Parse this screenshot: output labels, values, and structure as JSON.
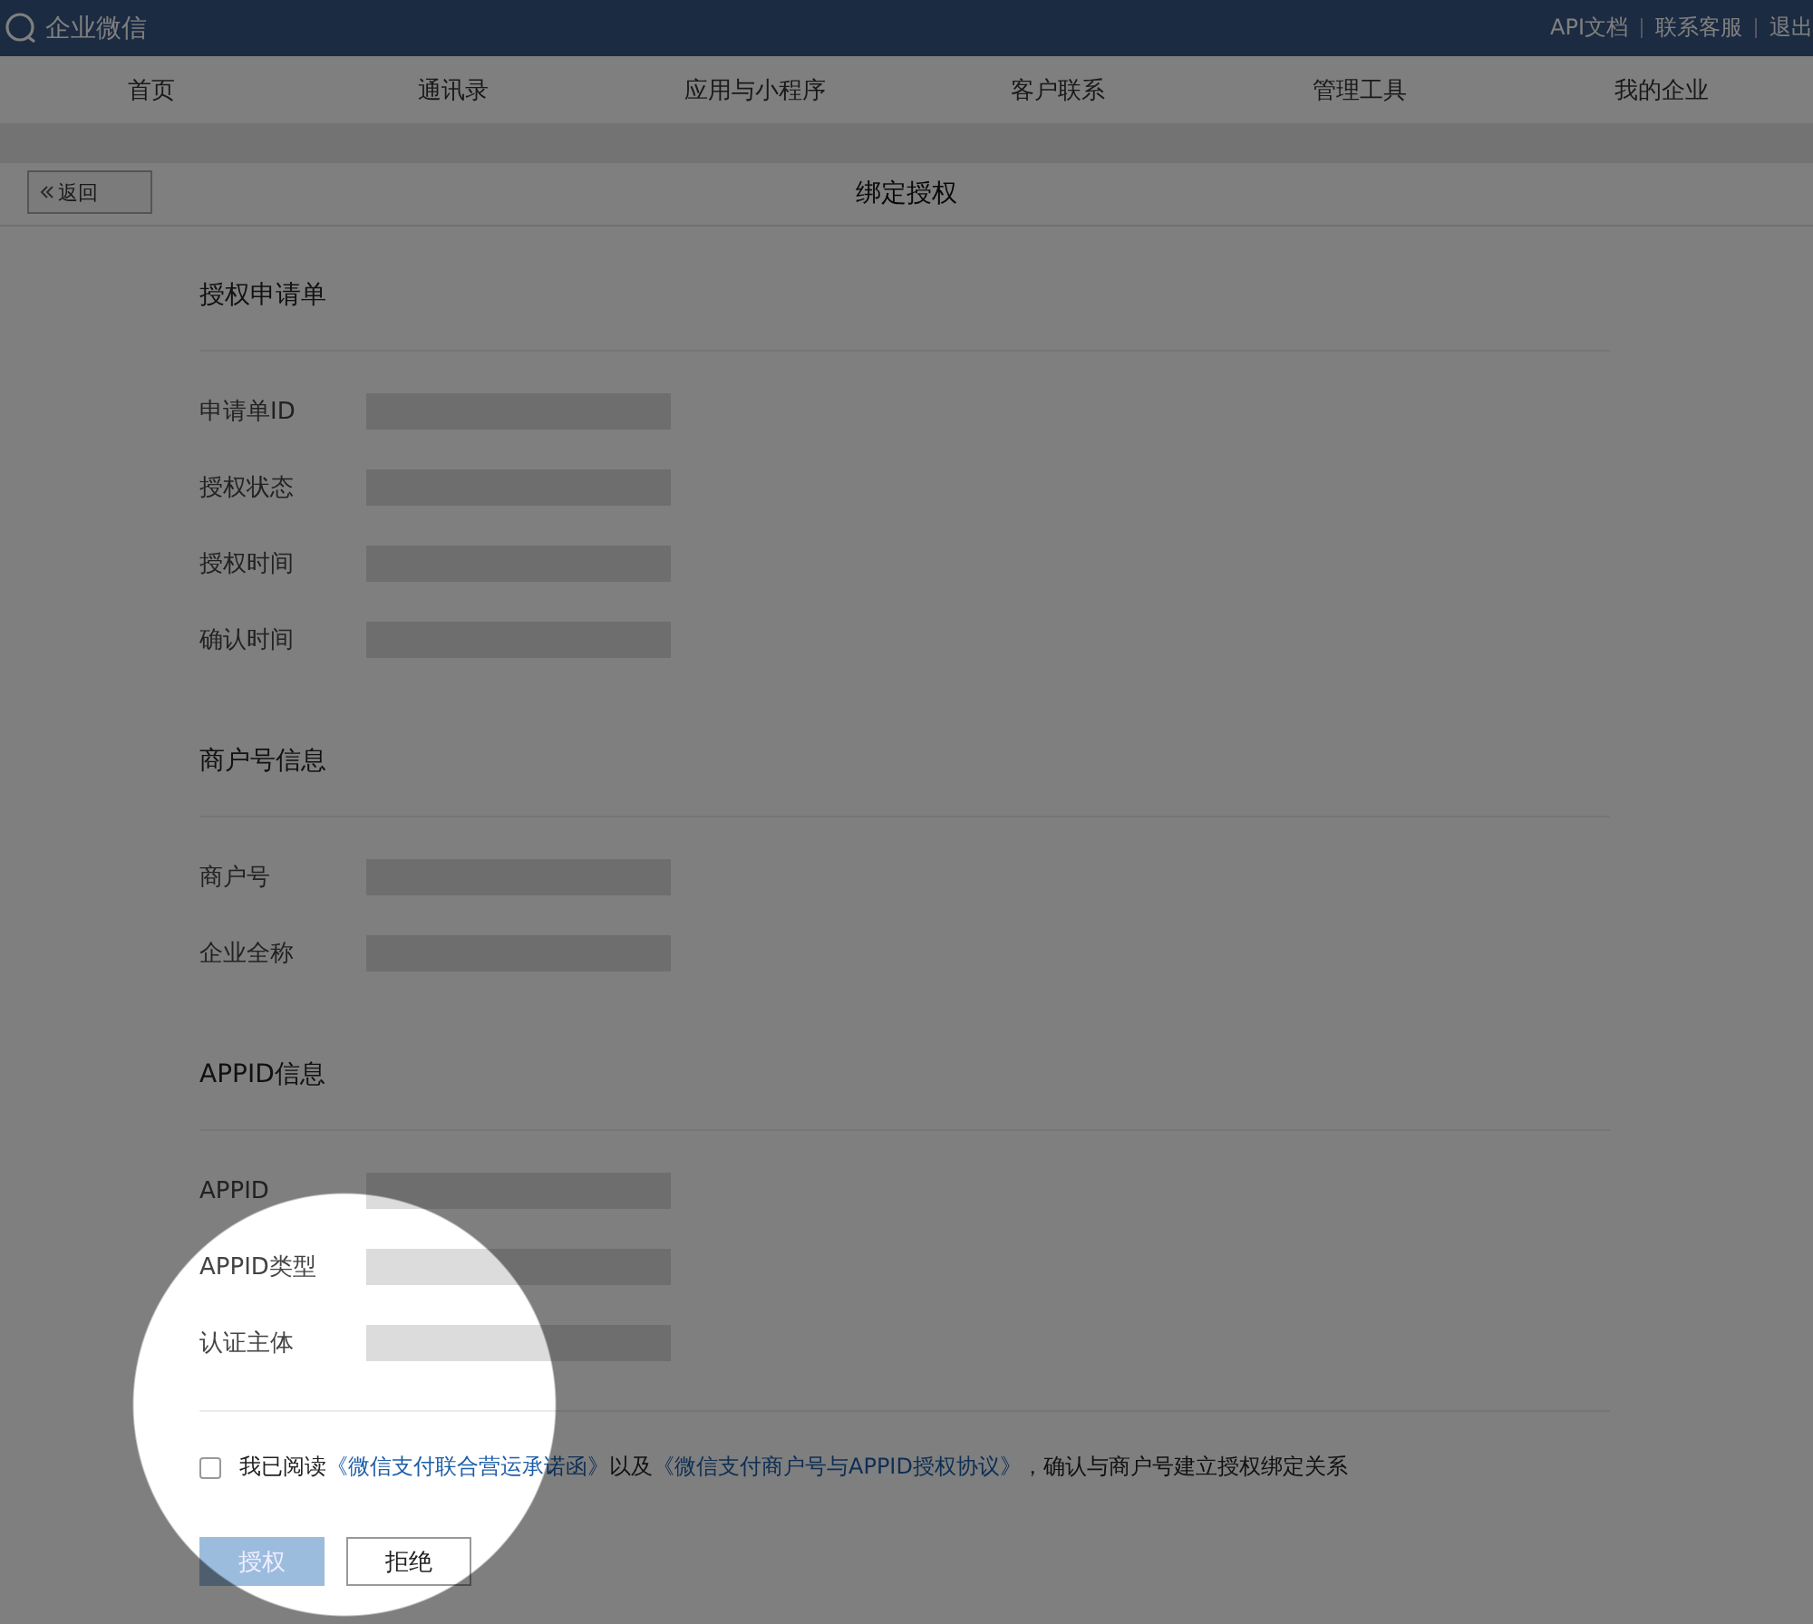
{
  "header": {
    "logo": "企业微信",
    "links": [
      "API文档",
      "联系客服",
      "退出"
    ]
  },
  "nav": [
    {
      "label": "首页",
      "selected": false
    },
    {
      "label": "通讯录",
      "selected": false
    },
    {
      "label": "应用与小程序",
      "selected": false
    },
    {
      "label": "客户联系",
      "selected": false
    },
    {
      "label": "管理工具",
      "selected": false
    },
    {
      "label": "我的企业",
      "selected": false
    }
  ],
  "page": {
    "back": "返回",
    "title": "绑定授权"
  },
  "sections": [
    {
      "title": "授权申请单",
      "fields": [
        {
          "label": "申请单ID"
        },
        {
          "label": "授权状态"
        },
        {
          "label": "授权时间"
        },
        {
          "label": "确认时间"
        }
      ]
    },
    {
      "title": "商户号信息",
      "fields": [
        {
          "label": "商户号"
        },
        {
          "label": "企业全称"
        }
      ]
    },
    {
      "title": "APPID信息",
      "fields": [
        {
          "label": "APPID"
        },
        {
          "label": "APPID类型"
        },
        {
          "label": "认证主体"
        }
      ]
    }
  ],
  "agreement": {
    "checked": false,
    "parts": [
      {
        "kind": "text",
        "text": "我已阅读"
      },
      {
        "kind": "link",
        "text": "《微信支付联合营运承诺函》"
      },
      {
        "kind": "text",
        "text": "以及"
      },
      {
        "kind": "link",
        "text": "《微信支付商户号与APPID授权协议》"
      },
      {
        "kind": "text",
        "text": "，确认与商户号建立授权绑定关系"
      }
    ]
  },
  "buttons": [
    {
      "label": "授权",
      "kind": "primary",
      "disabled": true
    },
    {
      "label": "拒绝",
      "kind": "default",
      "disabled": false
    }
  ]
}
